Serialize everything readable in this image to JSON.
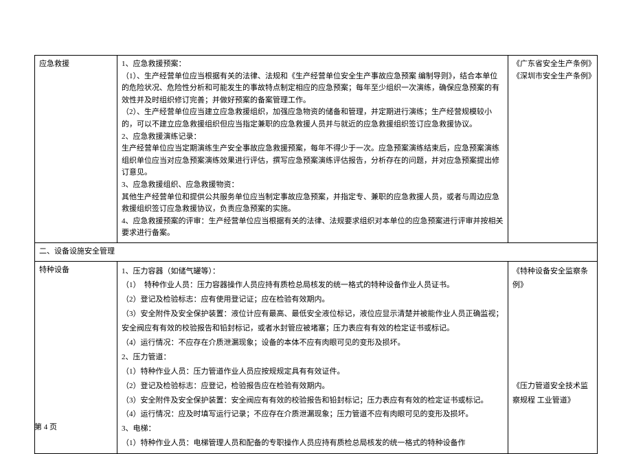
{
  "rows": [
    {
      "col1": "应急救援",
      "col2": [
        "1、应急救援预案：",
        "（1）、生产经营单位应当根据有关的法律、法规和《生产经营单位安全生产事故应急预案 编制导则》，结合本单位的危险状况、危险性分析和可能发生的事故特点制定相应的应急预案；每年至少组织一次演练，确保应急预案的有效性并及时组织修订完善；并做好预案的备案管理工作。",
        "（2）、生产经营单位应当建立应急救援组织，加强应急物资的储备和管理，并定期进行演练；生产经营规模较小的，可以不建立应急救援组织但应当指定兼职的应急救援人员并与就近的应急救援组织签订应急救援协议。",
        "2、应急救援演练记录：",
        "生产经营单位应当定期演练生产安全事故应急救援预案，每年不得少于一次。应急预案演练结束后，应急预案演练组织单位应当对应急预案演练效果进行评估，撰写应急预案演练评估报告，分析存在的问题，并对应急预案提出修订意见。",
        "3、应急救援组织、应急救援物资：",
        "其他生产经营单位和提供公共服务单位应当制定事故应急预案，并指定专、兼职的应急救援人员，或者与周边应急救援组织签订应急救援协议，负责应急预案的实施。",
        "4、应急救援预案的评审：生产经营单位应当根据有关的法律、法规要求组织对本单位的应急预案进行评审并按相关要求进行备案。"
      ],
      "col3": [
        "《广东省安全生产条例》",
        "《深圳市安全生产条例》"
      ]
    }
  ],
  "section_header": "二、设备设施安全管理",
  "rows2": [
    {
      "col1": "特种设备",
      "col2": [
        "1、压力容器（如储气罐等）：",
        "（1）　特种作业人员：压力容器操作人员应持有质检总局核发的统一格式的特种设备作业人员证书。",
        "（2）登记及检验标志：应有使用登记证；应在检验有效期内。",
        "（3）安全附件及安全保护装置：液位计应有最高、最低安全液位标记，液位应显示清楚并被能作业人员正确监视；安全阀应有有效的校验报告和铅封标记，或者水封管应被堵塞；压力表应有有效的检定证书或标记。",
        "（4）运行情况：不应存在介质泄漏现象；设备的本体不应有肉眼可见的变形及损坏。",
        "2、压力管道：",
        "（1）特种作业人员：压力管道作业人员应按规规定具有有效证件。",
        "（2）登记及检验标志：应登记，检验报告应在检验有效期内。",
        "（3）安全附件及安全保护装置：安全阀应有有效的校验报告和铅封标记；压力表应有有效的检定证书或标记。",
        "（4）运行情况：应及时填写运行记录；不应存在介质泄漏现象；压力管道不应有肉眼可见的变形及损坏。",
        "3、电梯：",
        "（1）特种作业人员：电梯管理人员和配备的专职操作人员应持有质检总局核发的统一格式的特种设备作"
      ],
      "col3": [
        "《特种设备安全监察条例》",
        "",
        "",
        "",
        "",
        "",
        "",
        "《压力管道安全技术监察规程 工业管道》"
      ]
    }
  ],
  "footer": "第 4 页"
}
